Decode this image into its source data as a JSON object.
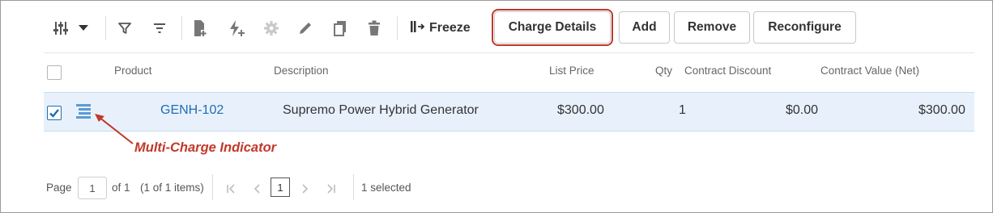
{
  "toolbar": {
    "freeze_label": "Freeze",
    "buttons": {
      "charge_details": "Charge Details",
      "add": "Add",
      "remove": "Remove",
      "reconfigure": "Reconfigure"
    },
    "icons": [
      "columns-settings-icon",
      "dropdown-caret-icon",
      "filter-icon",
      "sort-icon",
      "add-document-icon",
      "flash-add-icon",
      "gear-icon",
      "pencil-icon",
      "copy-icon",
      "trash-icon",
      "freeze-icon"
    ],
    "highlight_color": "#c0392b"
  },
  "table": {
    "columns": {
      "product": "Product",
      "description": "Description",
      "list_price": "List Price",
      "qty": "Qty",
      "contract_discount": "Contract Discount",
      "contract_value": "Contract Value (Net)"
    },
    "rows": [
      {
        "checked": true,
        "product": "GENH-102",
        "description": "Supremo Power Hybrid Generator",
        "list_price": "$300.00",
        "qty": "1",
        "contract_discount": "$0.00",
        "contract_value": "$300.00"
      }
    ],
    "selected_row_color": "#e8f1fb",
    "link_color": "#1f6db5"
  },
  "annotation": {
    "callout_text": "Multi-Charge Indicator",
    "color": "#c0392b"
  },
  "pagination": {
    "page_label": "Page",
    "page_value": "1",
    "of_label": "of 1",
    "items_label": "(1 of 1 items)",
    "current_page": "1",
    "selected_label": "1 selected"
  }
}
